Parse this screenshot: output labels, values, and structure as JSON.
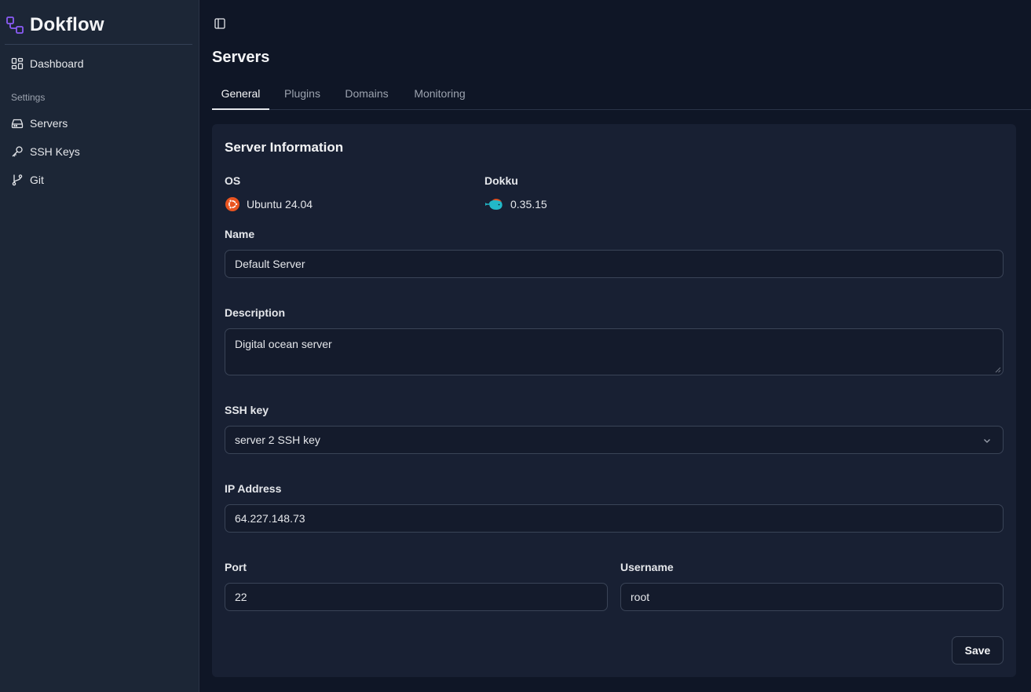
{
  "app": {
    "name": "Dokflow"
  },
  "sidebar": {
    "items": [
      {
        "label": "Dashboard",
        "icon": "dashboard-icon"
      },
      {
        "label": "Servers",
        "icon": "server-icon"
      },
      {
        "label": "SSH Keys",
        "icon": "key-icon"
      },
      {
        "label": "Git",
        "icon": "git-branch-icon"
      }
    ],
    "section_label": "Settings"
  },
  "page": {
    "title": "Servers"
  },
  "tabs": [
    {
      "label": "General",
      "active": true
    },
    {
      "label": "Plugins",
      "active": false
    },
    {
      "label": "Domains",
      "active": false
    },
    {
      "label": "Monitoring",
      "active": false
    }
  ],
  "server_info": {
    "title": "Server Information",
    "os_label": "OS",
    "os_value": "Ubuntu 24.04",
    "dokku_label": "Dokku",
    "dokku_value": "0.35.15"
  },
  "form": {
    "name_label": "Name",
    "name_value": "Default Server",
    "description_label": "Description",
    "description_value": "Digital ocean server",
    "ssh_key_label": "SSH key",
    "ssh_key_value": "server 2 SSH key",
    "ip_label": "IP Address",
    "ip_value": "64.227.148.73",
    "port_label": "Port",
    "port_value": "22",
    "username_label": "Username",
    "username_value": "root",
    "save_label": "Save"
  },
  "colors": {
    "sidebar_bg": "#1c2636",
    "main_bg": "#0f1626",
    "card_bg": "#182033",
    "brand_accent": "#8b5cf6",
    "ubuntu_orange": "#e95420",
    "dokku_teal": "#22b8c8"
  }
}
